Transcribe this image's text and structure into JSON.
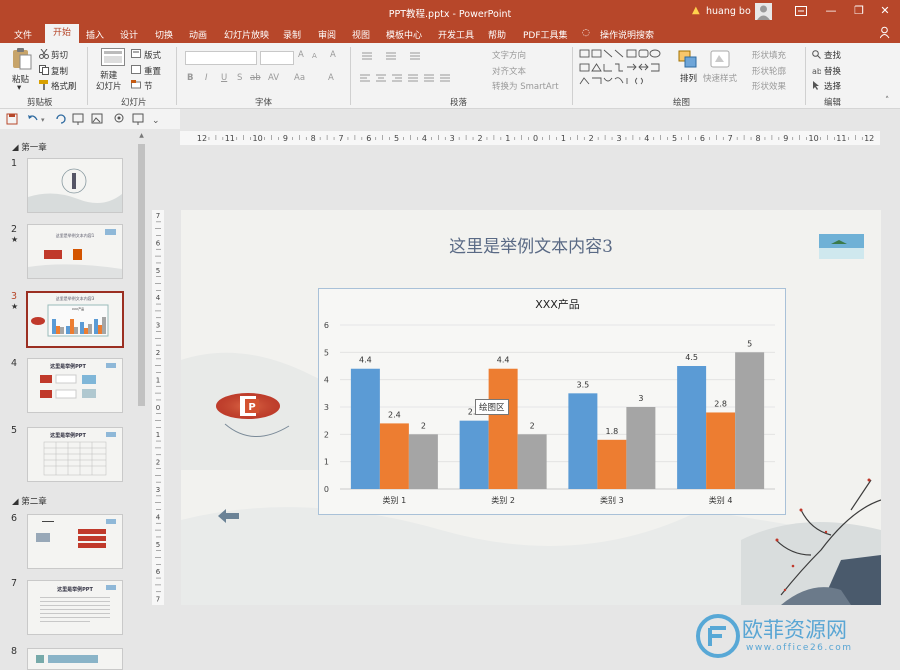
{
  "titlebar": {
    "doc_title": "PPT教程.pptx  -  PowerPoint",
    "user": "huang bo",
    "minimize": "—",
    "restore": "❐",
    "close": "✕"
  },
  "menu": {
    "file": "文件",
    "tabs": [
      "开始",
      "插入",
      "设计",
      "切换",
      "动画",
      "幻灯片放映",
      "录制",
      "审阅",
      "视图",
      "模板中心",
      "开发工具",
      "帮助",
      "PDF工具集"
    ],
    "active_tab": "开始",
    "tell_me": "操作说明搜索"
  },
  "ribbon": {
    "clipboard": {
      "paste": "粘贴",
      "cut": "剪切",
      "copy": "复制",
      "format_painter": "格式刷",
      "group": "剪贴板"
    },
    "slides": {
      "new_slide": "新建\n幻灯片",
      "layout": "版式",
      "reset": "重置",
      "section": "节",
      "group": "幻灯片"
    },
    "font": {
      "group": "字体",
      "bold": "B",
      "italic": "I",
      "underline": "U",
      "strike": "S",
      "shadow": "ab",
      "spacing": "AV",
      "case": "Aa",
      "grow": "A",
      "shrink": "A",
      "clear": "A",
      "color": "A"
    },
    "paragraph": {
      "group": "段落",
      "text_dir": "文字方向",
      "align_text": "对齐文本",
      "smartart": "转换为 SmartArt"
    },
    "drawing": {
      "group": "绘图",
      "arrange": "排列",
      "quick_styles": "快速样式",
      "fill": "形状填充",
      "outline": "形状轮廓",
      "effects": "形状效果"
    },
    "editing": {
      "group": "编辑",
      "find": "查找",
      "replace": "替换",
      "select": "选择"
    }
  },
  "panel": {
    "sections": [
      "第一章",
      "第二章"
    ],
    "slides": [
      {
        "num": "1",
        "star": ""
      },
      {
        "num": "2",
        "star": "★"
      },
      {
        "num": "3",
        "star": "★"
      },
      {
        "num": "4",
        "star": ""
      },
      {
        "num": "5",
        "star": ""
      },
      {
        "num": "6",
        "star": ""
      },
      {
        "num": "7",
        "star": ""
      },
      {
        "num": "8",
        "star": ""
      }
    ],
    "thumb_titles": {
      "s2": "这里是举例文本内容1",
      "s3": "XXX产品",
      "s4": "这里是举例PPT",
      "s5": "这里是举例PPT",
      "s7": "这里是举例PPT"
    }
  },
  "ruler": {
    "h_labels": [
      "12",
      "11",
      "10",
      "9",
      "8",
      "7",
      "6",
      "5",
      "4",
      "3",
      "2",
      "1",
      "0",
      "1",
      "2",
      "3",
      "4",
      "5",
      "6",
      "7",
      "8",
      "9",
      "10",
      "11",
      "12"
    ],
    "v_labels": [
      "7",
      "6",
      "5",
      "4",
      "3",
      "2",
      "1",
      "0",
      "1",
      "2",
      "3",
      "4",
      "5",
      "6",
      "7"
    ]
  },
  "slide": {
    "title": "这里是举例文本内容3",
    "tooltip": "绘图区"
  },
  "chart_data": {
    "type": "bar",
    "title": "XXX产品",
    "categories": [
      "类别 1",
      "类别 2",
      "类别 3",
      "类别 4"
    ],
    "series": [
      {
        "values": [
          4.4,
          2.5,
          3.5,
          4.5
        ],
        "color": "#5b9bd5"
      },
      {
        "values": [
          2.4,
          4.4,
          1.8,
          2.8
        ],
        "color": "#ed7d31"
      },
      {
        "values": [
          2,
          2,
          3,
          5
        ],
        "color": "#a5a5a5"
      }
    ],
    "value_labels": [
      [
        "4.4",
        "2.5",
        "3.5",
        "4.5"
      ],
      [
        "2.4",
        "4.4",
        "1.8",
        "2.8"
      ],
      [
        "2",
        "2",
        "3",
        "5"
      ]
    ],
    "ylim": [
      0,
      6
    ],
    "yticks": [
      "0",
      "1",
      "2",
      "3",
      "4",
      "5",
      "6"
    ],
    "grid": true,
    "legend": "none"
  },
  "watermark": {
    "text": "欧菲资源网",
    "url": "www.office26.com"
  },
  "colors": {
    "accent": "#b7472a",
    "selected_thumb": "#9b2f22"
  }
}
